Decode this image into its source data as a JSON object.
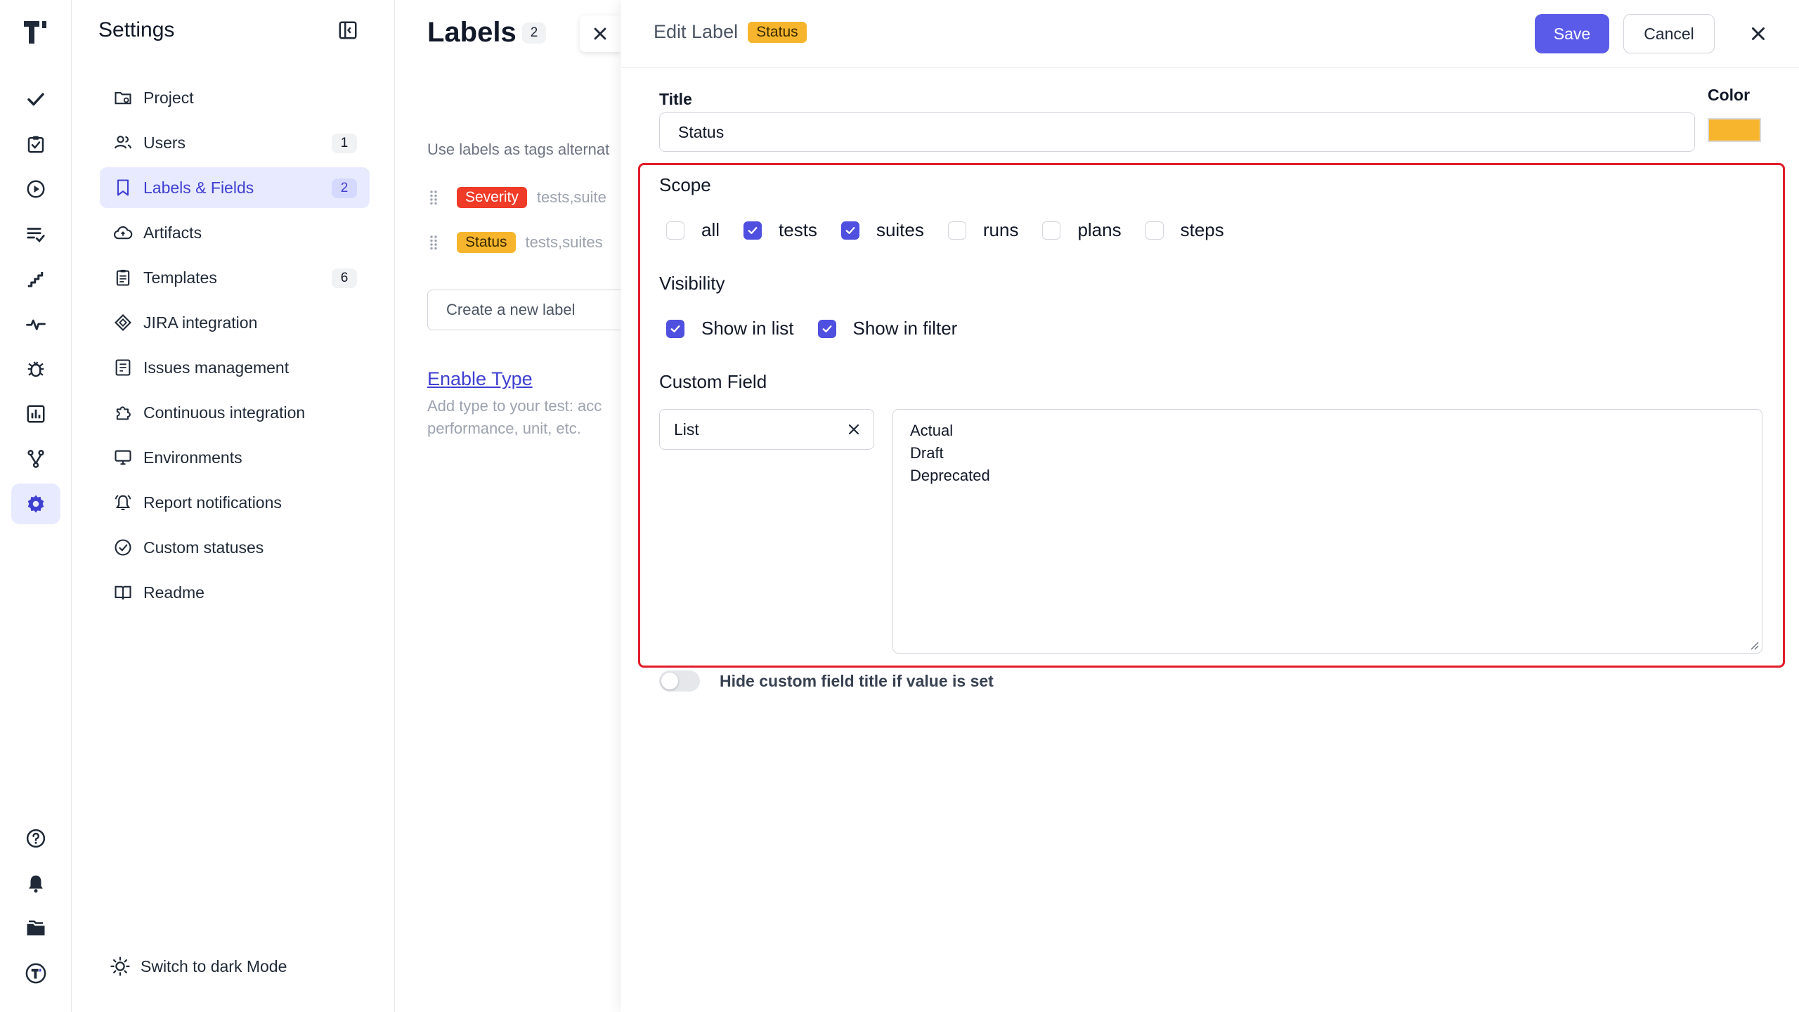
{
  "rail": {
    "items": [
      {
        "icon": "check-icon",
        "active": false
      },
      {
        "icon": "clipboard-check-icon",
        "active": false
      },
      {
        "icon": "play-circle-icon",
        "active": false
      },
      {
        "icon": "list-check-icon",
        "active": false
      },
      {
        "icon": "steps-icon",
        "active": false
      },
      {
        "icon": "pulse-icon",
        "active": false
      },
      {
        "icon": "bug-icon",
        "active": false
      },
      {
        "icon": "chart-icon",
        "active": false
      },
      {
        "icon": "branch-icon",
        "active": false
      },
      {
        "icon": "gear-icon",
        "active": true
      }
    ],
    "bottom": [
      "help-icon",
      "bell-icon",
      "folder-icon",
      "logo-circle-icon"
    ]
  },
  "sidebar": {
    "title": "Settings",
    "items": [
      {
        "label": "Project",
        "icon": "folder-settings-icon",
        "badge": ""
      },
      {
        "label": "Users",
        "icon": "users-icon",
        "badge": "1"
      },
      {
        "label": "Labels & Fields",
        "icon": "bookmark-icon",
        "badge": "2",
        "active": true
      },
      {
        "label": "Artifacts",
        "icon": "cloud-icon",
        "badge": ""
      },
      {
        "label": "Templates",
        "icon": "template-icon",
        "badge": "6"
      },
      {
        "label": "JIRA integration",
        "icon": "jira-icon",
        "badge": ""
      },
      {
        "label": "Issues management",
        "icon": "issues-icon",
        "badge": ""
      },
      {
        "label": "Continuous integration",
        "icon": "puzzle-icon",
        "badge": ""
      },
      {
        "label": "Environments",
        "icon": "monitor-icon",
        "badge": ""
      },
      {
        "label": "Report notifications",
        "icon": "bell-outline-icon",
        "badge": ""
      },
      {
        "label": "Custom statuses",
        "icon": "check-circle-icon",
        "badge": ""
      },
      {
        "label": "Readme",
        "icon": "book-icon",
        "badge": ""
      }
    ],
    "dark_mode_label": "Switch to dark Mode"
  },
  "labels_panel": {
    "title": "Labels",
    "count": "2",
    "hint": "Use labels as tags alternat",
    "labels": [
      {
        "name": "Severity",
        "scope": "tests,suite",
        "color": "#ef3b27"
      },
      {
        "name": "Status",
        "scope": "tests,suites",
        "color": "#f6b52c"
      }
    ],
    "new_label_placeholder": "Create a new label",
    "enable_type": "Enable Type",
    "enable_type_desc": "Add type to your test: acc performance, unit, etc."
  },
  "drawer": {
    "title": "Edit Label",
    "title_tag": "Status",
    "save_label": "Save",
    "cancel_label": "Cancel",
    "title_field_label": "Title",
    "title_value": "Status",
    "color_label": "Color",
    "color_value": "#f6b52c",
    "scope": {
      "title": "Scope",
      "options": [
        {
          "label": "all",
          "checked": false
        },
        {
          "label": "tests",
          "checked": true
        },
        {
          "label": "suites",
          "checked": true
        },
        {
          "label": "runs",
          "checked": false
        },
        {
          "label": "plans",
          "checked": false
        },
        {
          "label": "steps",
          "checked": false
        }
      ]
    },
    "visibility": {
      "title": "Visibility",
      "options": [
        {
          "label": "Show in list",
          "checked": true
        },
        {
          "label": "Show in filter",
          "checked": true
        }
      ]
    },
    "custom_field": {
      "title": "Custom Field",
      "type_value": "List",
      "values": [
        "Actual",
        "Draft",
        "Deprecated"
      ]
    },
    "hide_title_toggle_label": "Hide custom field title if value is set",
    "hide_title_toggle_on": false
  },
  "colors": {
    "accent": "#5b5bea",
    "highlight_border": "#e11d2a",
    "severity": "#ef3b27",
    "status": "#f6b52c"
  }
}
